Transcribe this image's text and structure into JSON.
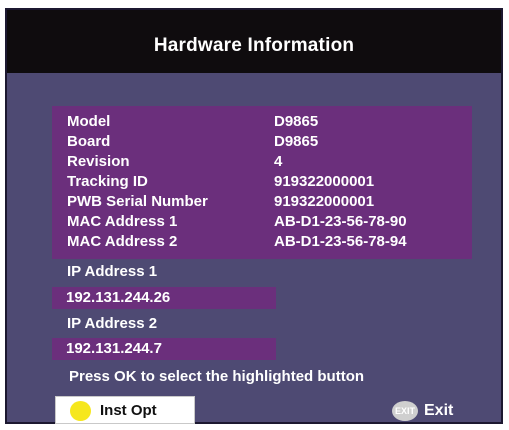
{
  "header": {
    "title": "Hardware Information"
  },
  "info": [
    {
      "label": "Model",
      "value": "D9865"
    },
    {
      "label": "Board",
      "value": "D9865"
    },
    {
      "label": "Revision",
      "value": "4"
    },
    {
      "label": "Tracking ID",
      "value": "919322000001"
    },
    {
      "label": "PWB Serial Number",
      "value": "919322000001"
    },
    {
      "label": "MAC Address 1",
      "value": "AB-D1-23-56-78-90"
    },
    {
      "label": "MAC Address 2",
      "value": "AB-D1-23-56-78-94"
    }
  ],
  "ip1": {
    "label": "IP Address 1",
    "value": "192.131.244.26"
  },
  "ip2": {
    "label": "IP Address 2",
    "value": "192.131.244.7"
  },
  "hint": "Press OK to select the highlighted button",
  "buttons": {
    "inst_opt": {
      "label": "Inst Opt",
      "icon": "yellow-button-icon"
    },
    "exit": {
      "key_label": "EXIT",
      "label": "Exit"
    }
  },
  "colors": {
    "background": "#4e4a73",
    "header": "#0f0c0e",
    "panel": "#6b2f7c",
    "yellow": "#f6e71d"
  }
}
